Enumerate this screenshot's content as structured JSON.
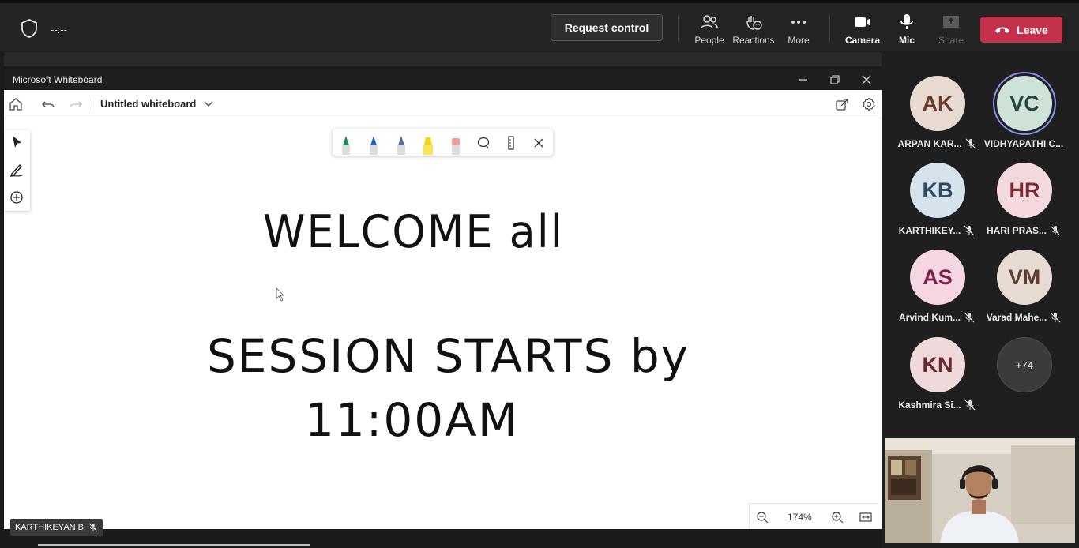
{
  "topbar": {
    "timer": "--:--",
    "request_control": "Request control",
    "people": "People",
    "reactions": "Reactions",
    "more": "More",
    "camera": "Camera",
    "mic": "Mic",
    "share": "Share",
    "leave": "Leave",
    "leave_color": "#c4314b"
  },
  "whiteboard": {
    "window_title": "Microsoft Whiteboard",
    "board_name": "Untitled whiteboard",
    "ink_lines": [
      "WELCOME all",
      "SESSION STARTS by",
      "11:00AM"
    ],
    "zoom": "174%"
  },
  "presenter_tag": "KARTHIKEYAN B",
  "participants": [
    {
      "initials": "AK",
      "name": "ARPAN KAR...",
      "bg": "#e8d9d2",
      "fg": "#6b3b2c",
      "muted": true
    },
    {
      "initials": "VC",
      "name": "VIDHYAPATHI C...",
      "bg": "#cfe2d8",
      "fg": "#25463a",
      "muted": false,
      "speaking": true
    },
    {
      "initials": "KB",
      "name": "KARTHIKEY...",
      "bg": "#d6e2ec",
      "fg": "#2f4a63",
      "muted": true
    },
    {
      "initials": "HR",
      "name": "HARI PRAS...",
      "bg": "#f4d9de",
      "fg": "#7b2a3a",
      "muted": true
    },
    {
      "initials": "AS",
      "name": "Arvind Kum...",
      "bg": "#f7d6e3",
      "fg": "#7d1f4a",
      "muted": true
    },
    {
      "initials": "VM",
      "name": "Varad Mahe...",
      "bg": "#e8dbd4",
      "fg": "#5b3f33",
      "muted": true
    },
    {
      "initials": "KN",
      "name": "Kashmira Si...",
      "bg": "#f0d9da",
      "fg": "#6e2630",
      "muted": true
    },
    {
      "initials": "+74",
      "name": "",
      "bg": "#3b3b3b",
      "fg": "#e6e6e6",
      "muted": false
    }
  ]
}
